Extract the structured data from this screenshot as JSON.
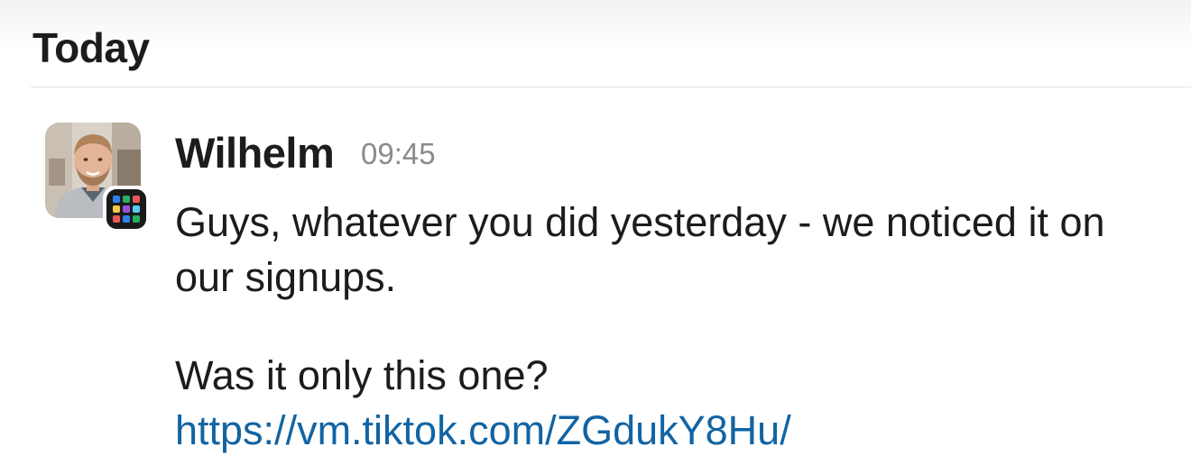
{
  "day_header": {
    "label": "Today"
  },
  "message": {
    "sender": "Wilhelm",
    "time": "09:45",
    "avatar_icon": "user-avatar-photo",
    "app_badge_icon": "app-grid-icon",
    "app_badge_colors": [
      "#2f80ed",
      "#27ae60",
      "#eb5757",
      "#f2c94c",
      "#9b51e0",
      "#56ccf2"
    ],
    "paragraph1": "Guys, whatever you did yesterday - we noticed it on our signups.",
    "paragraph2_text": "Was it only this one? ",
    "paragraph2_link": "https://vm.tiktok.com/ZGdukY8Hu/"
  },
  "colors": {
    "link": "#1264a3",
    "timestamp": "#8a8a8a",
    "text": "#1d1c1d"
  }
}
